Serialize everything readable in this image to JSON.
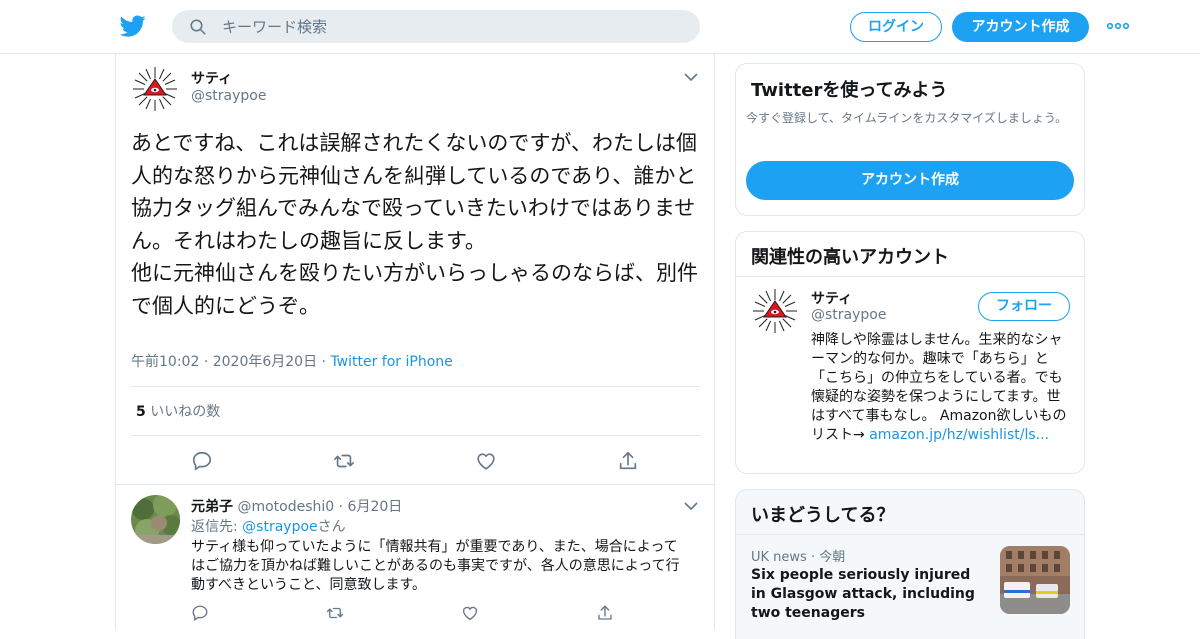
{
  "colors": {
    "accent": "#1da1f2",
    "link": "#1b95e0",
    "muted": "#657786",
    "border": "#e1e8ed"
  },
  "header": {
    "search_placeholder": "キーワード検索",
    "login_label": "ログイン",
    "signup_label": "アカウント作成"
  },
  "tweet": {
    "name": "サティ",
    "handle": "@straypoe",
    "text": "あとですね、これは誤解されたくないのですが、わたしは個人的な怒りから元神仙さんを糾弾しているのであり、誰かと協力タッグ組んでみんなで殴っていきたいわけではありません。それはわたしの趣旨に反します。\n他に元神仙さんを殴りたい方がいらっしゃるのならば、別件で個人的にどうぞ。",
    "time": "午前10:02",
    "date": "2020年6月20日",
    "via": "Twitter for iPhone",
    "likes_count": "5",
    "likes_label": "いいねの数"
  },
  "reply": {
    "name": "元弟子",
    "handle": "@motodeshi0",
    "date": "6月20日",
    "reply_prefix": "返信先: ",
    "reply_to": "@straypoe",
    "reply_suffix": "さん",
    "text": "サティ様も仰っていたように「情報共有」が重要であり、また、場合によってはご協力を頂かねば難しいことがあるのも事実ですが、各人の意思によって行動すべきということ、同意致します。"
  },
  "signup_card": {
    "title": "Twitterを使ってみよう",
    "subtitle": "今すぐ登録して、タイムラインをカスタマイズしましょう。",
    "button": "アカウント作成"
  },
  "related_card": {
    "title": "関連性の高いアカウント",
    "name": "サティ",
    "handle": "@straypoe",
    "follow_label": "フォロー",
    "bio": "神降しや除霊はしません。生来的なシャーマン的な何か。趣味で「あちら」と「こちら」の仲立ちをしている者。でも懐疑的な姿勢を保つようにしてます。世はすべて事もなし。 Amazon欲しいものリスト→ ",
    "bio_link": "amazon.jp/hz/wishlist/ls..."
  },
  "trends_card": {
    "title": "いまどうしてる？",
    "source": "UK news",
    "time": "今朝",
    "headline": "Six people seriously injured in Glasgow attack, including two teenagers"
  },
  "icons": [
    "twitter-logo-icon",
    "search-icon",
    "more-icon",
    "chevron-down-icon",
    "reply-icon",
    "retweet-icon",
    "like-icon",
    "share-icon"
  ]
}
